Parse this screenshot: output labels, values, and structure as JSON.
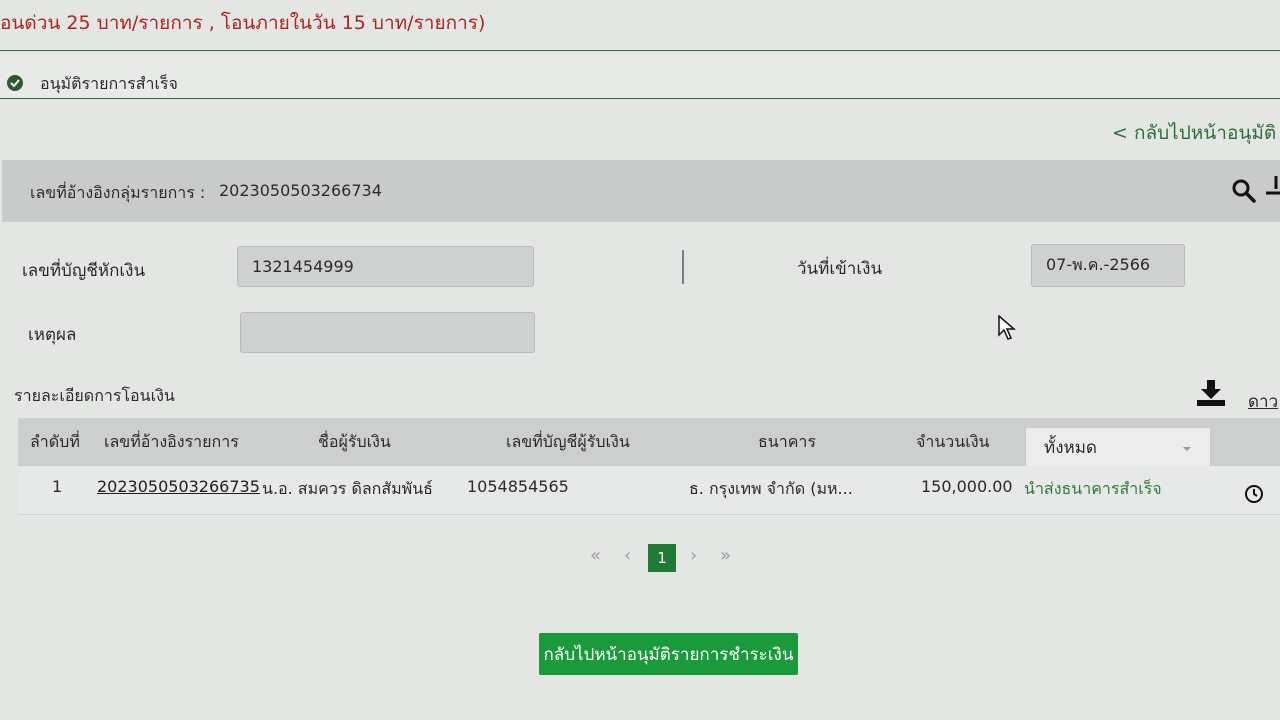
{
  "notice": "อนด่วน 25 บาท/รายการ , โอนภายในวัน 15 บาท/รายการ)",
  "status_message": "อนุมัติรายการสำเร็จ",
  "back_link": "< กลับไปหน้าอนุมัติ",
  "group_ref": {
    "label": "เลขที่อ้างอิงกลุ่มรายการ :",
    "value": "2023050503266734"
  },
  "form": {
    "debit_account_label": "เลขที่บัญชีหักเงิน",
    "debit_account_value": "1321454999",
    "credit_date_label": "วันที่เข้าเงิน",
    "credit_date_value": "07-พ.ค.-2566",
    "reason_label": "เหตุผล",
    "reason_value": ""
  },
  "transfer_details": {
    "title": "รายละเอียดการโอนเงิน",
    "download_label": "ดาว"
  },
  "table": {
    "headers": {
      "seq": "ลำดับที่",
      "ref": "เลขที่อ้างอิงรายการ",
      "payee": "ชื่อผู้รับเงิน",
      "account": "เลขที่บัญชีผู้รับเงิน",
      "bank": "ธนาคาร",
      "amount": "จำนวนเงิน"
    },
    "status_filter": "ทั้งหมด",
    "rows": [
      {
        "seq": "1",
        "ref": "2023050503266735",
        "payee": "น.อ. สมควร ดิลกสัมพันธ์",
        "account": "1054854565",
        "bank": "ธ. กรุงเทพ จำกัด (มห...",
        "amount": "150,000.00",
        "status": "นำส่งธนาคารสำเร็จ"
      }
    ]
  },
  "pagination": {
    "first": "«",
    "prev": "‹",
    "current": "1",
    "next": "›",
    "last": "»"
  },
  "return_button": "กลับไปหน้าอนุมัติรายการชำระเงิน",
  "colors": {
    "accent_green": "#1a9a3b",
    "notice_red": "#b0241e",
    "status_green": "#2f7a3c"
  }
}
